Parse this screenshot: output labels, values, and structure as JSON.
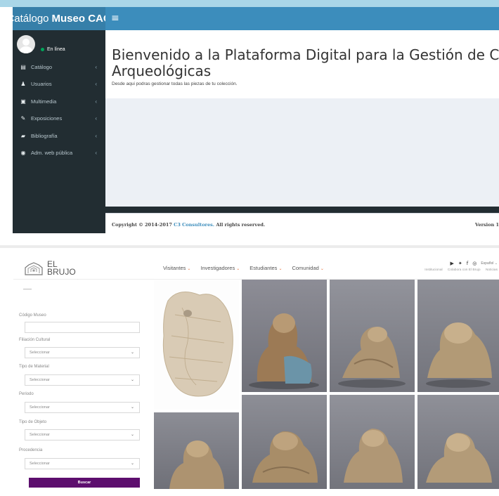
{
  "admin": {
    "brand_prefix": "Catálogo",
    "brand_name": "Museo CAO",
    "toggle_icon": "hamburger-icon",
    "user_status": "En línea",
    "menu": [
      {
        "label": "Catálogo",
        "icon": "archive-icon"
      },
      {
        "label": "Usuarios",
        "icon": "user-icon"
      },
      {
        "label": "Multimedia",
        "icon": "image-icon"
      },
      {
        "label": "Exposiciones",
        "icon": "brush-icon"
      },
      {
        "label": "Bibliografía",
        "icon": "book-icon"
      },
      {
        "label": "Adm. web pública",
        "icon": "globe-icon"
      }
    ],
    "title": "Bienvenido a la Plataforma Digital para la Gestión de Colecciones Arqueológicas",
    "subtitle": "Desde aqui podras gestionar todas las piezas de tu colección.",
    "footer": {
      "copyright_prefix": "Copyright © 2014-2017",
      "company": "C3 Consultores.",
      "copyright_suffix": "All rights reserved.",
      "version": "Version 1"
    },
    "colors": {
      "header": "#3c8dbc",
      "sidebar": "#222d32",
      "online": "#00a65a"
    }
  },
  "site": {
    "logo_line1": "EL",
    "logo_line2": "BRUJO",
    "logo_sub": "COMPLEJO ARQUEOLÓGICO",
    "nav": [
      "Visitantes",
      "Investigadores",
      "Estudiantes",
      "Comunidad"
    ],
    "social_icons": [
      "youtube-icon",
      "twitter-icon",
      "facebook-icon",
      "instagram-icon"
    ],
    "language": "Español",
    "top_links": [
      "Institucional",
      "Colabora con El Brujo",
      "Noticias"
    ],
    "filters": {
      "codigo_label": "Código Museo",
      "codigo_value": "",
      "selects": [
        {
          "label": "Filiación Cultural",
          "value": "Seleccionar"
        },
        {
          "label": "Tipo de Material",
          "value": "Seleccionar"
        },
        {
          "label": "Periodo",
          "value": "Seleccionar"
        },
        {
          "label": "Tipo de Objeto",
          "value": "Seleccionar"
        },
        {
          "label": "Procedencia",
          "value": "Seleccionar"
        }
      ],
      "button": "Buscar"
    },
    "colors": {
      "accent": "#e8703a",
      "button": "#5d0e6e"
    }
  }
}
